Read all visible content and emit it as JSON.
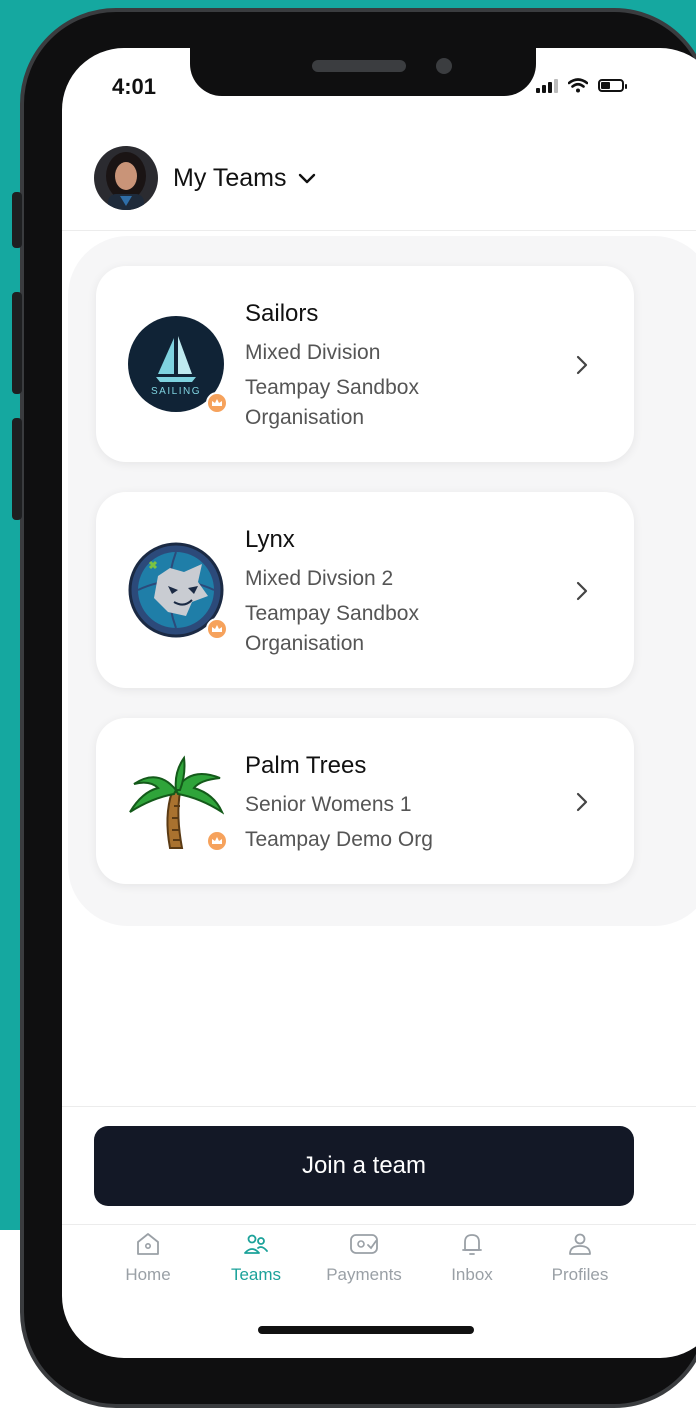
{
  "status_bar": {
    "time": "4:01"
  },
  "header": {
    "title": "My Teams"
  },
  "teams": [
    {
      "name": "Sailors",
      "lines": [
        "Mixed Division",
        "Teampay Sandbox",
        "Organisation"
      ],
      "logo": "sailing-logo",
      "logo_text": "SAILING"
    },
    {
      "name": "Lynx",
      "lines": [
        "Mixed Divsion 2",
        "Teampay Sandbox",
        "Organisation"
      ],
      "logo": "lynx-logo"
    },
    {
      "name": "Palm Trees",
      "lines": [
        "Senior Womens 1",
        "Teampay Demo Org"
      ],
      "logo": "palm-tree-logo"
    }
  ],
  "join_button": {
    "label": "Join a team"
  },
  "tabbar": {
    "items": [
      {
        "label": "Home",
        "icon": "home-icon",
        "active": false
      },
      {
        "label": "Teams",
        "icon": "teams-icon",
        "active": true
      },
      {
        "label": "Payments",
        "icon": "payments-icon",
        "active": false
      },
      {
        "label": "Inbox",
        "icon": "bell-icon",
        "active": false
      },
      {
        "label": "Profiles",
        "icon": "profile-icon",
        "active": false
      }
    ]
  },
  "colors": {
    "accent": "#1ca29a",
    "background": "#15a8a0",
    "button": "#131826",
    "badge": "#f6a25c"
  }
}
